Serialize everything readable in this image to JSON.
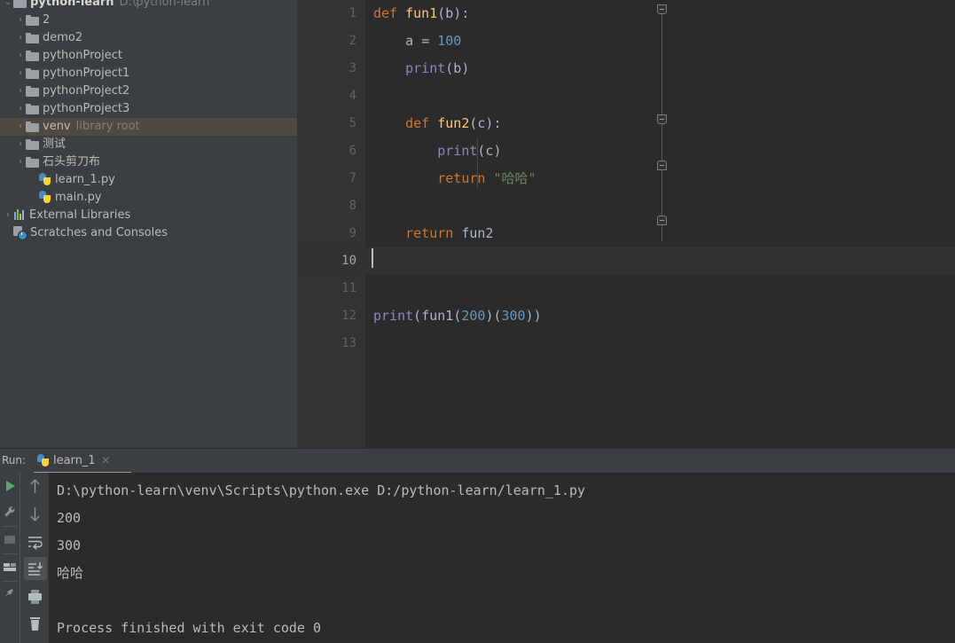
{
  "project_tree": {
    "items": [
      {
        "label": "python-learn",
        "sublabel": "D:\\python-learn",
        "icon": "folder-icon",
        "arrow": "⌄",
        "indent": 0,
        "bold": true,
        "selected": false,
        "name": "tree-item-python-learn"
      },
      {
        "label": "2",
        "sublabel": "",
        "icon": "folder-icon",
        "arrow": "›",
        "indent": 1,
        "bold": false,
        "selected": false,
        "name": "tree-item-2"
      },
      {
        "label": "demo2",
        "sublabel": "",
        "icon": "folder-icon",
        "arrow": "›",
        "indent": 1,
        "bold": false,
        "selected": false,
        "name": "tree-item-demo2"
      },
      {
        "label": "pythonProject",
        "sublabel": "",
        "icon": "folder-icon",
        "arrow": "›",
        "indent": 1,
        "bold": false,
        "selected": false,
        "name": "tree-item-pythonproject"
      },
      {
        "label": "pythonProject1",
        "sublabel": "",
        "icon": "folder-icon",
        "arrow": "›",
        "indent": 1,
        "bold": false,
        "selected": false,
        "name": "tree-item-pythonproject1"
      },
      {
        "label": "pythonProject2",
        "sublabel": "",
        "icon": "folder-icon",
        "arrow": "›",
        "indent": 1,
        "bold": false,
        "selected": false,
        "name": "tree-item-pythonproject2"
      },
      {
        "label": "pythonProject3",
        "sublabel": "",
        "icon": "folder-icon",
        "arrow": "›",
        "indent": 1,
        "bold": false,
        "selected": false,
        "name": "tree-item-pythonproject3"
      },
      {
        "label": "venv",
        "sublabel": "library root",
        "icon": "folder-icon",
        "arrow": "›",
        "indent": 1,
        "bold": false,
        "selected": true,
        "name": "tree-item-venv"
      },
      {
        "label": "测试",
        "sublabel": "",
        "icon": "folder-icon",
        "arrow": "›",
        "indent": 1,
        "bold": false,
        "selected": false,
        "name": "tree-item-ceshi"
      },
      {
        "label": "石头剪刀布",
        "sublabel": "",
        "icon": "folder-icon",
        "arrow": "›",
        "indent": 1,
        "bold": false,
        "selected": false,
        "name": "tree-item-shitoujiandaobu"
      },
      {
        "label": "learn_1.py",
        "sublabel": "",
        "icon": "python-file-icon",
        "arrow": "",
        "indent": 2,
        "bold": false,
        "selected": false,
        "name": "tree-item-learn-1-py"
      },
      {
        "label": "main.py",
        "sublabel": "",
        "icon": "python-file-icon",
        "arrow": "",
        "indent": 2,
        "bold": false,
        "selected": false,
        "name": "tree-item-main-py"
      },
      {
        "label": "External Libraries",
        "sublabel": "",
        "icon": "libraries-icon",
        "arrow": "›",
        "indent": 0,
        "bold": false,
        "selected": false,
        "name": "tree-item-external-libraries"
      },
      {
        "label": "Scratches and Consoles",
        "sublabel": "",
        "icon": "scratches-icon",
        "arrow": "",
        "indent": 0,
        "bold": false,
        "selected": false,
        "name": "tree-item-scratches-and-consoles"
      }
    ]
  },
  "editor": {
    "current_line": 10,
    "line_numbers": [
      "1",
      "2",
      "3",
      "4",
      "5",
      "6",
      "7",
      "8",
      "9",
      "10",
      "11",
      "12",
      "13"
    ],
    "lines": [
      {
        "n": 1,
        "tokens": [
          {
            "t": "def",
            "c": "kw"
          },
          {
            "t": " ",
            "c": "plain"
          },
          {
            "t": "fun1",
            "c": "fn"
          },
          {
            "t": "(b):",
            "c": "plain"
          }
        ]
      },
      {
        "n": 2,
        "tokens": [
          {
            "t": "    a ",
            "c": "plain"
          },
          {
            "t": "=",
            "c": "plain"
          },
          {
            "t": " ",
            "c": "plain"
          },
          {
            "t": "100",
            "c": "num"
          }
        ]
      },
      {
        "n": 3,
        "tokens": [
          {
            "t": "    ",
            "c": "plain"
          },
          {
            "t": "print",
            "c": "call"
          },
          {
            "t": "(b)",
            "c": "plain"
          }
        ]
      },
      {
        "n": 4,
        "tokens": []
      },
      {
        "n": 5,
        "tokens": [
          {
            "t": "    ",
            "c": "plain"
          },
          {
            "t": "def",
            "c": "kw"
          },
          {
            "t": " ",
            "c": "plain"
          },
          {
            "t": "fun2",
            "c": "fn"
          },
          {
            "t": "(c):",
            "c": "plain"
          }
        ]
      },
      {
        "n": 6,
        "tokens": [
          {
            "t": "        ",
            "c": "plain"
          },
          {
            "t": "print",
            "c": "call"
          },
          {
            "t": "(c)",
            "c": "plain"
          }
        ]
      },
      {
        "n": 7,
        "tokens": [
          {
            "t": "        ",
            "c": "plain"
          },
          {
            "t": "return",
            "c": "kw"
          },
          {
            "t": " ",
            "c": "plain"
          },
          {
            "t": "\"哈哈\"",
            "c": "str"
          }
        ]
      },
      {
        "n": 8,
        "tokens": []
      },
      {
        "n": 9,
        "tokens": [
          {
            "t": "    ",
            "c": "plain"
          },
          {
            "t": "return",
            "c": "kw"
          },
          {
            "t": " fun2",
            "c": "plain"
          }
        ]
      },
      {
        "n": 10,
        "tokens": []
      },
      {
        "n": 11,
        "tokens": []
      },
      {
        "n": 12,
        "tokens": [
          {
            "t": "print",
            "c": "call"
          },
          {
            "t": "(",
            "c": "plain"
          },
          {
            "t": "fun1",
            "c": "plain"
          },
          {
            "t": "(",
            "c": "plain"
          },
          {
            "t": "200",
            "c": "num"
          },
          {
            "t": ")(",
            "c": "plain"
          },
          {
            "t": "300",
            "c": "num"
          },
          {
            "t": "))",
            "c": "plain"
          }
        ]
      },
      {
        "n": 13,
        "tokens": []
      }
    ],
    "colors": {
      "background": "#2b2b2b",
      "gutter_background": "#313335",
      "current_line": "#323232",
      "keyword": "#cc7832",
      "function": "#ffc66d",
      "number": "#6897bb",
      "string": "#6a8759",
      "call": "#8888c6",
      "text": "#a9b7c6"
    }
  },
  "run_panel": {
    "label": "Run:",
    "tab": {
      "title": "learn_1",
      "icon": "python-file-icon",
      "close": "×"
    },
    "left_tools": [
      {
        "name": "rerun-button",
        "icon": "play-icon"
      },
      {
        "name": "edit-configurations-button",
        "icon": "wrench-icon"
      },
      {
        "name": "stop-button",
        "icon": "stop-square-icon"
      },
      {
        "name": "layout-settings-button",
        "icon": "layout-icon"
      },
      {
        "name": "pin-tab-button",
        "icon": "pin-icon"
      }
    ],
    "console_tools": [
      {
        "name": "up-the-stack-trace-button",
        "icon": "arrow-up-icon",
        "active": false
      },
      {
        "name": "down-the-stack-trace-button",
        "icon": "arrow-down-icon",
        "active": false
      },
      {
        "name": "soft-wrap-button",
        "icon": "soft-wrap-icon",
        "active": false
      },
      {
        "name": "scroll-to-end-button",
        "icon": "scroll-to-end-icon",
        "active": true
      },
      {
        "name": "print-button",
        "icon": "printer-icon",
        "active": false
      },
      {
        "name": "clear-all-button",
        "icon": "trash-icon",
        "active": false
      }
    ],
    "console_output": [
      "D:\\python-learn\\venv\\Scripts\\python.exe D:/python-learn/learn_1.py",
      "200",
      "300",
      "哈哈",
      "",
      "Process finished with exit code 0"
    ]
  }
}
